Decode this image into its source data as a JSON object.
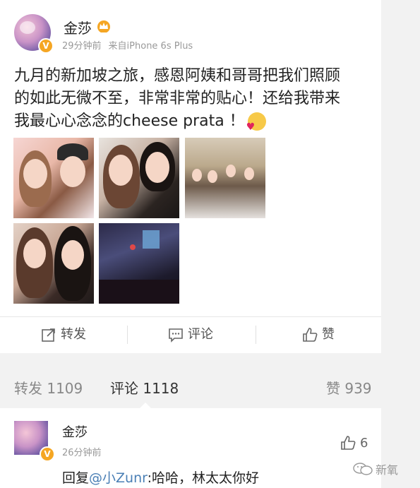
{
  "post": {
    "username": "金莎",
    "time": "29分钟前",
    "source": "来自iPhone 6s Plus",
    "content_line1": "九月的新加坡之旅，感恩阿姨和哥哥把我们照顾",
    "content_line2": "的如此无微不至，非常非常的贴心！还给我带来",
    "content_line3": "我最心心念念的cheese prata ！"
  },
  "actions": {
    "repost_label": "转发",
    "comment_label": "评论",
    "like_label": "赞"
  },
  "stats": {
    "repost": "转发 1109",
    "comment": "评论 1118",
    "like": "赞 939"
  },
  "comment": {
    "username": "金莎",
    "time": "26分钟前",
    "likes": "6",
    "reply_prefix": "回复",
    "mention": "@小Zunr",
    "reply_text": ":哈哈，林太太你好"
  },
  "watermark": {
    "label": "新氧"
  },
  "icons": [
    "verified-badge-icon",
    "crown-icon",
    "emoji-icon",
    "repost-icon",
    "comment-icon",
    "like-icon",
    "thumbs-up-icon",
    "wechat-icon"
  ],
  "colors": {
    "accent": "#f5a623",
    "mention": "#4a7fb5"
  }
}
